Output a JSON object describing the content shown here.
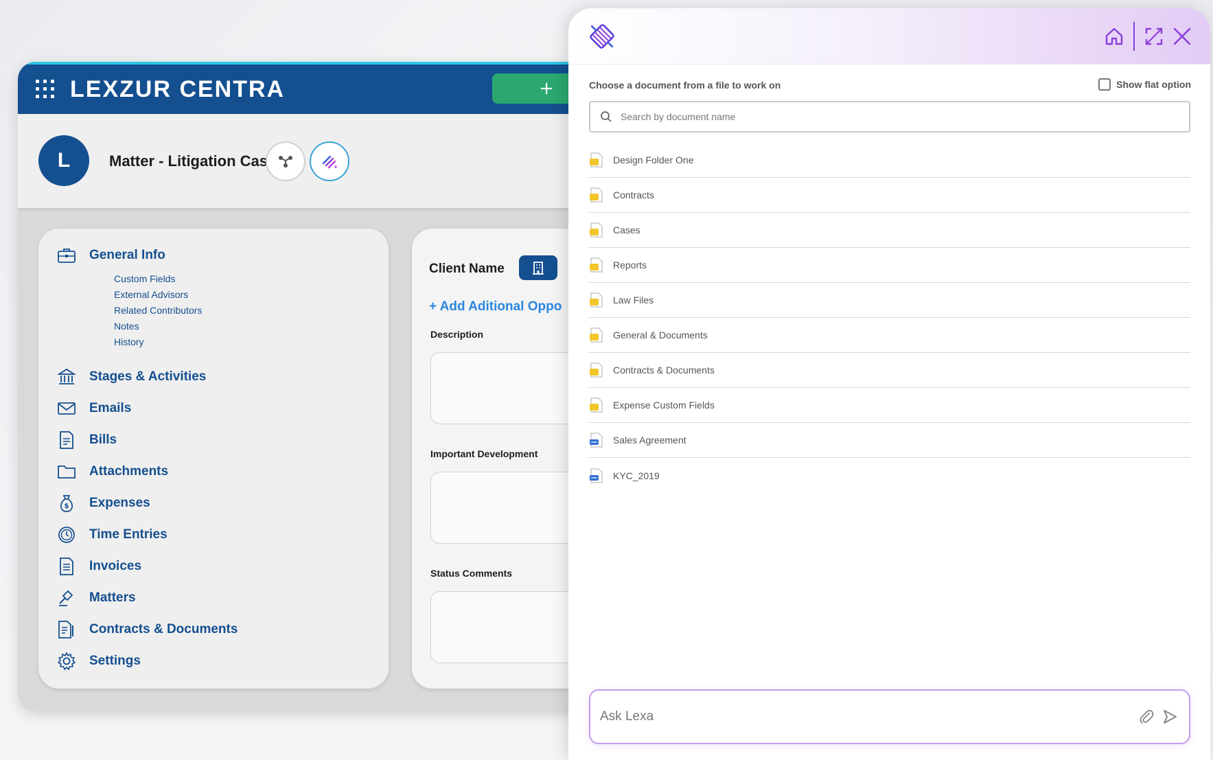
{
  "app": {
    "logo_text": "LEXZUR CENTRA",
    "new_button_label": "+",
    "avatar_letter": "L",
    "matter_title": "Matter - Litigation Case"
  },
  "sidebar": {
    "general_info": "General Info",
    "sub_items": [
      "Custom Fields",
      "External Advisors",
      "Related Contributors",
      "Notes",
      "History"
    ],
    "items": [
      {
        "label": "Stages & Activities",
        "icon": "bank-icon"
      },
      {
        "label": "Emails",
        "icon": "mail-icon"
      },
      {
        "label": "Bills",
        "icon": "bill-icon"
      },
      {
        "label": "Attachments",
        "icon": "folder-icon"
      },
      {
        "label": "Expenses",
        "icon": "money-bag-icon"
      },
      {
        "label": "Time Entries",
        "icon": "clock-icon"
      },
      {
        "label": "Invoices",
        "icon": "invoice-icon"
      },
      {
        "label": "Matters",
        "icon": "gavel-icon"
      },
      {
        "label": "Contracts & Documents",
        "icon": "contract-icon"
      },
      {
        "label": "Settings",
        "icon": "gear-icon"
      }
    ]
  },
  "form": {
    "client_name_label": "Client Name",
    "add_link": "+  Add Aditional Oppo",
    "description_label": "Description",
    "important_label": "Important Development",
    "status_label": "Status Comments"
  },
  "panel": {
    "choose_label": "Choose a document from a file to work on",
    "flat_option_label": "Show flat option",
    "search_placeholder": "Search by document name",
    "documents": [
      {
        "name": "Design Folder One",
        "type": "folder"
      },
      {
        "name": "Contracts",
        "type": "folder"
      },
      {
        "name": "Cases",
        "type": "folder"
      },
      {
        "name": "Reports",
        "type": "folder"
      },
      {
        "name": "Law Files",
        "type": "folder"
      },
      {
        "name": "General & Documents",
        "type": "folder"
      },
      {
        "name": "Contracts & Documents",
        "type": "folder"
      },
      {
        "name": "Expense Custom Fields",
        "type": "folder"
      },
      {
        "name": "Sales Agreement",
        "type": "doc"
      },
      {
        "name": "KYC_2019",
        "type": "doc"
      }
    ],
    "ask_placeholder": "Ask Lexa"
  },
  "colors": {
    "brand_blue": "#144f8f",
    "accent_green": "#2aa870",
    "accent_purple": "#8b3fd9",
    "link_blue": "#2a86e0"
  }
}
